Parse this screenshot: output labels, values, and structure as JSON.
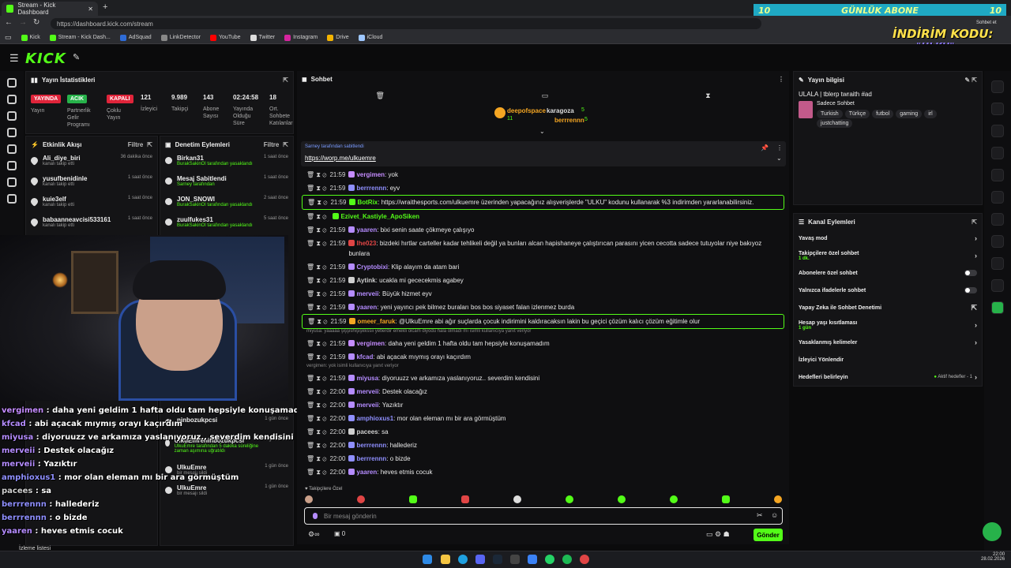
{
  "browser": {
    "tabs": [
      {
        "label": "Stream - Kick Dashboard"
      }
    ],
    "url": "https://dashboard.kick.com/stream",
    "bookmarks": [
      {
        "label": "Kick",
        "color": "#53fc18"
      },
      {
        "label": "Stream - Kick Dash...",
        "color": "#53fc18"
      },
      {
        "label": "AdSquad",
        "color": "#2e6bd6"
      },
      {
        "label": "LinkDetector",
        "color": "#888888"
      },
      {
        "label": "YouTube",
        "color": "#ff0000"
      },
      {
        "label": "Twitter",
        "color": "#dddddd"
      },
      {
        "label": "Instagram",
        "color": "#d6249f"
      },
      {
        "label": "Drive",
        "color": "#f4b400"
      },
      {
        "label": "iCloud",
        "color": "#9ec7ff"
      }
    ],
    "side_label": "Sohbet et",
    "side_label2": "tvlanlar"
  },
  "promo": {
    "count_left": "10",
    "text": "GÜNLÜK ABONE",
    "count_right": "10",
    "discount": "İNDİRİM KODU:",
    "code": "\"ULKU\""
  },
  "stats": {
    "title": "Yayın İstatistikleri",
    "badges": [
      {
        "label": "YAYINDA",
        "color": "#e0243a",
        "caption": "Yayın"
      },
      {
        "label": "ACIK",
        "color": "#27b24a",
        "caption": "Partnerlik Gelir Programı"
      },
      {
        "label": "KAPALI",
        "color": "#e0243a",
        "caption": "Çoklu Yayın"
      }
    ],
    "items": [
      {
        "value": "121",
        "label": "İzleyici"
      },
      {
        "value": "9.989",
        "label": "Takipçi"
      },
      {
        "value": "143",
        "label": "Abone Sayısı"
      },
      {
        "value": "02:24:58",
        "label": "Yayında Olduğu Süre"
      },
      {
        "value": "18",
        "label": "Ort. Sohbete Katılanlar"
      }
    ]
  },
  "activity": {
    "title": "Etkinlik Akışı",
    "filter": "Filtre",
    "items": [
      {
        "name": "Ali_diye_biri",
        "sub": "kanalı takip etti",
        "time": "36 dakika önce"
      },
      {
        "name": "yusufbenidinle",
        "sub": "kanalı takip etti",
        "time": "1 saat önce"
      },
      {
        "name": "kuie3elf",
        "sub": "kanalı takip etti",
        "time": "1 saat önce"
      },
      {
        "name": "babaanneavcisi533161",
        "sub": "kanalı takip etti",
        "time": "1 saat önce"
      }
    ]
  },
  "moderation": {
    "title": "Denetim Eylemleri",
    "filter": "Filtre",
    "items": [
      {
        "name": "Birkan31",
        "sub": "BurakSakinOl tarafından yasaklandı",
        "time": "1 saat önce"
      },
      {
        "name": "Mesaj Sabitlendi",
        "sub": "Sarney tarafından",
        "time": "1 saat önce"
      },
      {
        "name": "JON_SNOWI",
        "sub": "BurakSakinOl tarafından yasaklandı",
        "time": "2 saat önce"
      },
      {
        "name": "zuulfukes31",
        "sub": "BurakSakinOl tarafından yasaklandı",
        "time": "5 saat önce"
      },
      {
        "name": "ninbozukpcsi",
        "sub": "",
        "time": "1 gün önce"
      },
      {
        "name": "UlkuEmreninbozukpcsi",
        "sub": "UlkuEmre tarafından 5 dakika süreliğine zaman aşımına uğratıldı",
        "time": "1 gün önce"
      },
      {
        "name": "UlkuEmre",
        "sub": "bir mesajı sildi",
        "time": "1 gün önce"
      },
      {
        "name": "UlkuEmre",
        "sub": "bir mesajı sildi",
        "time": "1 gün önce"
      }
    ]
  },
  "chat": {
    "title": "Sohbet",
    "gifters": [
      {
        "name": "deepofspace",
        "count": "11"
      },
      {
        "name": "karagoza",
        "count": "5"
      },
      {
        "name": "berrrennn",
        "count": "5"
      }
    ],
    "pinned": {
      "by": "Sarney tarafından sabitlendi",
      "link": "https://worp.me/ulkuemre"
    },
    "messages": [
      {
        "time": "21:59",
        "user": "vergimen",
        "color": "#c58cff",
        "text": "yok",
        "hl": false
      },
      {
        "time": "21:59",
        "user": "berrrennn",
        "color": "#8f8fff",
        "text": "eyv",
        "hl": false
      },
      {
        "time": "21:59",
        "user": "BotRix",
        "color": "#53fc18",
        "text": "https://wraithesports.com/ulkuemre üzerinden yapacağınız alışverişlerde \"ULKU\" kodunu kullanarak %3 indirimden yararlanabilirsiniz.",
        "hl": true
      },
      {
        "time": "",
        "user": "Ezivet_Kastiyle_ApoSiken",
        "color": "#53fc18",
        "text": "",
        "hl": false
      },
      {
        "time": "21:59",
        "user": "yaaren",
        "color": "#b58cff",
        "text": "bixi senin saate çökmeye çalışıyo",
        "hl": false
      },
      {
        "time": "21:59",
        "user": "lhe023",
        "color": "#e04545",
        "text": "bizdeki hırtlar carteller kadar tehlikeli değil ya bunları alcan hapishaneye çalıştırıcan parasını yicen cecotta sadece tutuyolar niye bakıyoz bunlara",
        "hl": false
      },
      {
        "time": "21:59",
        "user": "Cryptobixi",
        "color": "#b58cff",
        "text": "Klip alayım da atam bari",
        "hl": false
      },
      {
        "time": "21:59",
        "user": "Aytink",
        "color": "#cfcfcf",
        "text": "ucakla mi gececekmis agabey",
        "hl": false
      },
      {
        "time": "21:59",
        "user": "merveii",
        "color": "#b58cff",
        "text": "Büyük hizmet eyv",
        "hl": false
      },
      {
        "time": "21:59",
        "user": "yaaren",
        "color": "#b58cff",
        "text": "yeni yayıncı pek bilmez buraları bos bos siyaset falan izlenmez burda",
        "hl": false
      },
      {
        "time": "21:59",
        "user": "omeer_faruk",
        "color": "#f5a623",
        "text": "@UlkuEmre abi ağır suçlarda çocuk indirimini kaldıracaksın lakin bu geçici çözüm kalıcı çözüm eğitimle olur",
        "hl": true
      },
      {
        "time": "21:59",
        "user": "vergimen",
        "color": "#c58cff",
        "text": "daha yeni geldim 1 hafta oldu tam hepsiyle konuşamadım",
        "hl": false,
        "reply": "miyusa: yaaaaa şişşishişişkkssii yetlerdir emekli olcam diyodu hala olmadı mı isimli kullanıcıya yanıt veriyor"
      },
      {
        "time": "21:59",
        "user": "kfcad",
        "color": "#b58cff",
        "text": "abi açacak mıymış orayı kaçırdım",
        "hl": false
      },
      {
        "time": "21:59",
        "user": "miyusa",
        "color": "#b58cff",
        "text": "diyoruuzz ve arkamıza yaslanıyoruz.. severdim kendisini",
        "hl": false,
        "reply": "vergimen: yok isimli kullanıcıya yanıt veriyor"
      },
      {
        "time": "22:00",
        "user": "merveii",
        "color": "#b58cff",
        "text": "Destek olacağız",
        "hl": false
      },
      {
        "time": "22:00",
        "user": "merveii",
        "color": "#b58cff",
        "text": "Yazıktır",
        "hl": false
      },
      {
        "time": "22:00",
        "user": "amphioxus1",
        "color": "#8f8fff",
        "text": "mor olan eleman mı bir ara görmüştüm",
        "hl": false
      },
      {
        "time": "22:00",
        "user": "pacees",
        "color": "#cfcfcf",
        "text": "sa",
        "hl": false
      },
      {
        "time": "22:00",
        "user": "berrrennn",
        "color": "#8f8fff",
        "text": "hallederiz",
        "hl": false
      },
      {
        "time": "22:00",
        "user": "berrrennn",
        "color": "#8f8fff",
        "text": "o bizde",
        "hl": false
      },
      {
        "time": "22:00",
        "user": "yaaren",
        "color": "#b58cff",
        "text": "heves etmis cocuk",
        "hl": false
      }
    ],
    "followers_only": "Takipçilere Özel",
    "input_placeholder": "Bir mesaj gönderin",
    "send_label": "Gönder",
    "points": "0"
  },
  "stream_info": {
    "title": "Yayın bilgisi",
    "stream_title": "ULALA | tblerp twraith #ad",
    "category": "Sadece Sohbet",
    "tags": [
      "Turkish",
      "Türkçe",
      "futbol",
      "gaming",
      "irl",
      "justchatting"
    ]
  },
  "channel_actions": {
    "title": "Kanal Eylemleri",
    "rows": [
      {
        "label": "Yavaş mod",
        "type": "chev"
      },
      {
        "label": "Takipçilere özel sohbet",
        "sub": "1 dk.",
        "type": "chev"
      },
      {
        "label": "Abonelere özel sohbet",
        "type": "toggle"
      },
      {
        "label": "Yalnızca ifadelerle sohbet",
        "type": "toggle"
      },
      {
        "label": "Yapay Zeka ile Sohbet Denetimi",
        "type": "ext"
      },
      {
        "label": "Hesap yaşı kısıtlaması",
        "sub": "1 gün",
        "type": "chev"
      },
      {
        "label": "Yasaklanmış kelimeler",
        "type": "chev"
      },
      {
        "label": "İzleyici Yönlendir",
        "type": "none"
      },
      {
        "label": "Hedefleri belirleyin",
        "sub_right": "Aktif hedefler - 1",
        "type": "chev"
      }
    ]
  },
  "overlay_chat": [
    {
      "user": "vergimen",
      "text": "daha yeni geldim 1 hafta oldu tam hepsiyle konuşamadım",
      "color": "#c58cff"
    },
    {
      "user": "kfcad",
      "text": "abi açacak mıymış orayı kaçırdım",
      "color": "#b58cff"
    },
    {
      "user": "miyusa",
      "text": "diyoruuzz ve arkamıza yaslanıyoruz.. severdim kendisini",
      "color": "#b58cff"
    },
    {
      "user": "merveii",
      "text": "Destek olacağız",
      "color": "#b58cff"
    },
    {
      "user": "merveii",
      "text": "Yazıktır",
      "color": "#b58cff"
    },
    {
      "user": "amphioxus1",
      "text": "mor olan eleman mı bir ara görmüştüm",
      "color": "#8f8fff"
    },
    {
      "user": "pacees",
      "text": "sa",
      "color": "#cfcfcf"
    },
    {
      "user": "berrrennn",
      "text": "hallederiz",
      "color": "#8f8fff"
    },
    {
      "user": "berrrennn",
      "text": "o bizde",
      "color": "#8f8fff"
    },
    {
      "user": "yaaren",
      "text": "heves etmis cocuk",
      "color": "#b58cff"
    }
  ],
  "taskbar": {
    "left_label": "İzleme listesi",
    "time": "22:00",
    "date": "28.02.2026"
  }
}
